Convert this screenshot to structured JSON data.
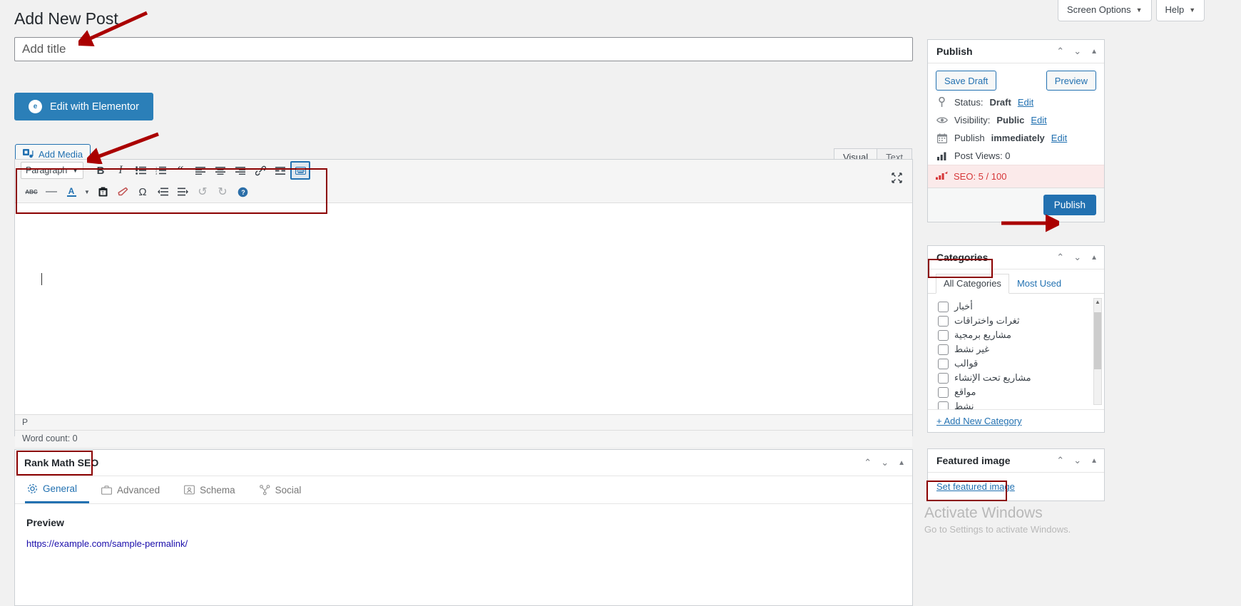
{
  "screen_meta": {
    "screen_options": "Screen Options",
    "help": "Help",
    "caret": "▼"
  },
  "page_title": "Add New Post",
  "title_input": {
    "value": "",
    "placeholder": "Add title"
  },
  "elementor": {
    "label": "Edit with Elementor",
    "logo_glyph": "e"
  },
  "add_media": {
    "label": "Add Media",
    "icon": "media-icon"
  },
  "editor": {
    "tabs": [
      {
        "label": "Visual",
        "active": true
      },
      {
        "label": "Text",
        "active": false
      }
    ],
    "format_select": {
      "value": "Paragraph",
      "caret": "▼"
    },
    "toolbar_row1": [
      {
        "name": "bold",
        "glyph": "B"
      },
      {
        "name": "italic",
        "glyph": "I"
      },
      {
        "name": "bulleted-list",
        "glyph": "☰"
      },
      {
        "name": "numbered-list",
        "glyph": "☷"
      },
      {
        "name": "blockquote",
        "glyph": "❝"
      },
      {
        "name": "align-left",
        "glyph": "≡"
      },
      {
        "name": "align-center",
        "glyph": "≡"
      },
      {
        "name": "align-right",
        "glyph": "≡"
      },
      {
        "name": "insert-link",
        "glyph": "🔗"
      },
      {
        "name": "read-more",
        "glyph": "▬"
      },
      {
        "name": "toolbar-toggle",
        "glyph": "⌨"
      }
    ],
    "toolbar_row2": [
      {
        "name": "strikethrough",
        "glyph": "ABC"
      },
      {
        "name": "horizontal-line",
        "glyph": "—"
      },
      {
        "name": "text-color",
        "glyph": "A"
      },
      {
        "name": "text-color-caret",
        "glyph": "▼"
      },
      {
        "name": "paste-as-text",
        "glyph": "📋"
      },
      {
        "name": "clear-formatting",
        "glyph": "⌫"
      },
      {
        "name": "special-character",
        "glyph": "Ω"
      },
      {
        "name": "decrease-indent",
        "glyph": "⇤"
      },
      {
        "name": "increase-indent",
        "glyph": "⇥"
      },
      {
        "name": "undo",
        "glyph": "↺"
      },
      {
        "name": "redo",
        "glyph": "↻"
      },
      {
        "name": "keyboard-shortcuts",
        "glyph": "?"
      }
    ],
    "fullscreen_icon": "⤢",
    "content": "",
    "path": "P",
    "word_count": "Word count: 0"
  },
  "rank_math": {
    "title": "Rank Math SEO",
    "tabs": [
      {
        "label": "General",
        "icon": "gear-icon",
        "glyph": "⚙",
        "active": true
      },
      {
        "label": "Advanced",
        "icon": "briefcase-icon",
        "glyph": "🧰",
        "active": false
      },
      {
        "label": "Schema",
        "icon": "schema-icon",
        "glyph": "🗂",
        "active": false
      },
      {
        "label": "Social",
        "icon": "share-icon",
        "glyph": "⋔",
        "active": false
      }
    ],
    "preview_label": "Preview",
    "preview_url": "https://example.com/sample-permalink/"
  },
  "sidebar": {
    "publish": {
      "title": "Publish",
      "save_draft": "Save Draft",
      "preview": "Preview",
      "rows": [
        {
          "icon": "pin-icon",
          "glyph": "📍",
          "label": "Status:",
          "value": "Draft",
          "edit": "Edit"
        },
        {
          "icon": "eye-icon",
          "glyph": "👁",
          "label": "Visibility:",
          "value": "Public",
          "edit": "Edit"
        },
        {
          "icon": "calendar-icon",
          "glyph": "📅",
          "label": "Publish",
          "value": "immediately",
          "edit": "Edit"
        },
        {
          "icon": "bar-chart-icon",
          "glyph": "📊",
          "label": "Post Views: 0",
          "value": "",
          "edit": ""
        }
      ],
      "seo_score": {
        "icon": "rank-math-icon",
        "glyph": "📶",
        "label": "SEO: 5 / 100"
      },
      "publish_button": "Publish"
    },
    "categories": {
      "title": "Categories",
      "tabs": [
        {
          "label": "All Categories",
          "active": true
        },
        {
          "label": "Most Used",
          "active": false
        }
      ],
      "items": [
        {
          "label": "أخبار",
          "child": false,
          "checked": false
        },
        {
          "label": "ثغرات واختراقات",
          "child": false,
          "checked": false
        },
        {
          "label": "مشاريع برمجية",
          "child": false,
          "checked": false
        },
        {
          "label": "غير نشط",
          "child": true,
          "checked": false
        },
        {
          "label": "قوالب",
          "child": true,
          "checked": false
        },
        {
          "label": "مشاريع تحت الإنشاء",
          "child": true,
          "checked": false
        },
        {
          "label": "مواقع",
          "child": true,
          "checked": false
        },
        {
          "label": "نشط",
          "child": true,
          "checked": false
        }
      ],
      "add_new": "+ Add New Category"
    },
    "featured_image": {
      "title": "Featured image",
      "set_link": "Set featured image"
    },
    "panel_controls": {
      "up": "⌃",
      "down": "⌄",
      "collapse": "▲"
    }
  },
  "watermark": {
    "line1": "Activate Windows",
    "line2": "Go to Settings to activate Windows."
  },
  "colors": {
    "accent": "#2271b1",
    "elementor": "#2b7fb8",
    "annotation": "#8b0000",
    "seo_red": "#d63638",
    "seo_bg": "#fbeaea"
  }
}
